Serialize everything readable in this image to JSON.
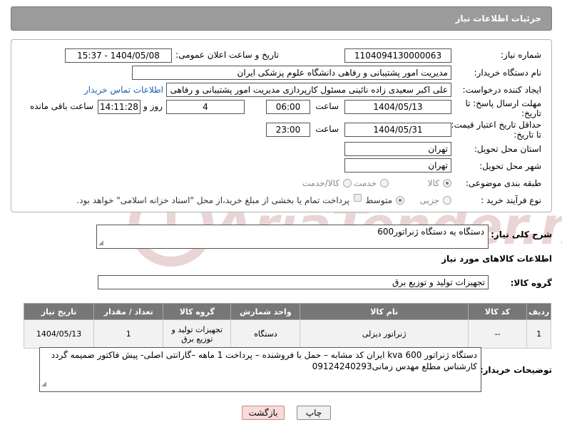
{
  "header": {
    "title": "جزئیات اطلاعات نیاز"
  },
  "form": {
    "need_number_label": "شماره نیاز:",
    "need_number": "1104094130000063",
    "announce_label": "تاریخ و ساعت اعلان عمومی:",
    "announce_value": "1404/05/08 - 15:37",
    "buyer_org_label": "نام دستگاه خریدار:",
    "buyer_org": "مدیریت امور پشتیبانی و رفاهی دانشگاه علوم پزشکی ایران",
    "creator_label": "ایجاد کننده درخواست:",
    "creator": "علی اکبر سعیدی زاده نائینی مسئول کارپردازی مدیریت امور پشتیبانی و رفاهی",
    "contact_link": "اطلاعات تماس خریدار",
    "deadline_label_1": "مهلت ارسال پاسخ: تا",
    "deadline_label_2": "تاریخ:",
    "deadline_date": "1404/05/13",
    "time_label": "ساعت",
    "deadline_time": "06:00",
    "days_value": "4",
    "days_label": "روز و",
    "remaining_time": "14:11:28",
    "remaining_label": "ساعت باقی مانده",
    "validity_label_1": "حداقل تاریخ اعتبار قیمت:",
    "validity_label_2": "تا تاریخ:",
    "validity_date": "1404/05/31",
    "validity_time": "23:00",
    "province_label": "استان محل تحویل:",
    "province": "تهران",
    "city_label": "شهر محل تحویل:",
    "city": "تهران",
    "category_label": "طبقه بندی موضوعی:",
    "category_options": [
      "کالا",
      "خدمت",
      "کالا/خدمت"
    ],
    "category_selected": "کالا",
    "process_label": "نوع فرآیند خرید :",
    "process_options": [
      "جزیی",
      "متوسط"
    ],
    "process_selected": "متوسط",
    "payment_note": "پرداخت تمام یا بخشی از مبلغ خرید،از محل \"اسناد خزانه اسلامی\" خواهد بود."
  },
  "description": {
    "label": "شرح کلی نیاز:",
    "value": "دستگاه یه دستگاه ژنراتور600"
  },
  "goods": {
    "section_title": "اطلاعات کالاهای مورد نیاز",
    "group_label": "گروه کالا:",
    "group_value": "تجهیزات تولید و توزیع برق",
    "columns": [
      "ردیف",
      "کد کالا",
      "نام کالا",
      "واحد شمارش",
      "گروه کالا",
      "تعداد / مقدار",
      "تاریخ نیاز"
    ],
    "rows": [
      {
        "row": "1",
        "code": "--",
        "name": "ژنراتور دیزلی",
        "unit": "دستگاه",
        "group": "تجهیزات تولید و توزیع برق",
        "qty": "1",
        "date": "1404/05/13"
      }
    ]
  },
  "buyer_notes": {
    "label": "توضیحات خریدار:",
    "value": "دستگاه ژنراتور kva 600 ایران کد مشابه – حمل با فروشنده – پرداخت 1 ماهه –گارانتی اصلی-  پیش فاکتور ضمیمه گردد کارشناس مطلع مهدس زمانی09124240293"
  },
  "buttons": {
    "print": "چاپ",
    "back": "بازگشت"
  },
  "watermark": "AriaTender.net",
  "colors": {
    "title_bg": "#9b9b9b",
    "table_header_bg": "#777777",
    "link": "#1a5fb4",
    "back_button_bg": "#f8dada"
  }
}
